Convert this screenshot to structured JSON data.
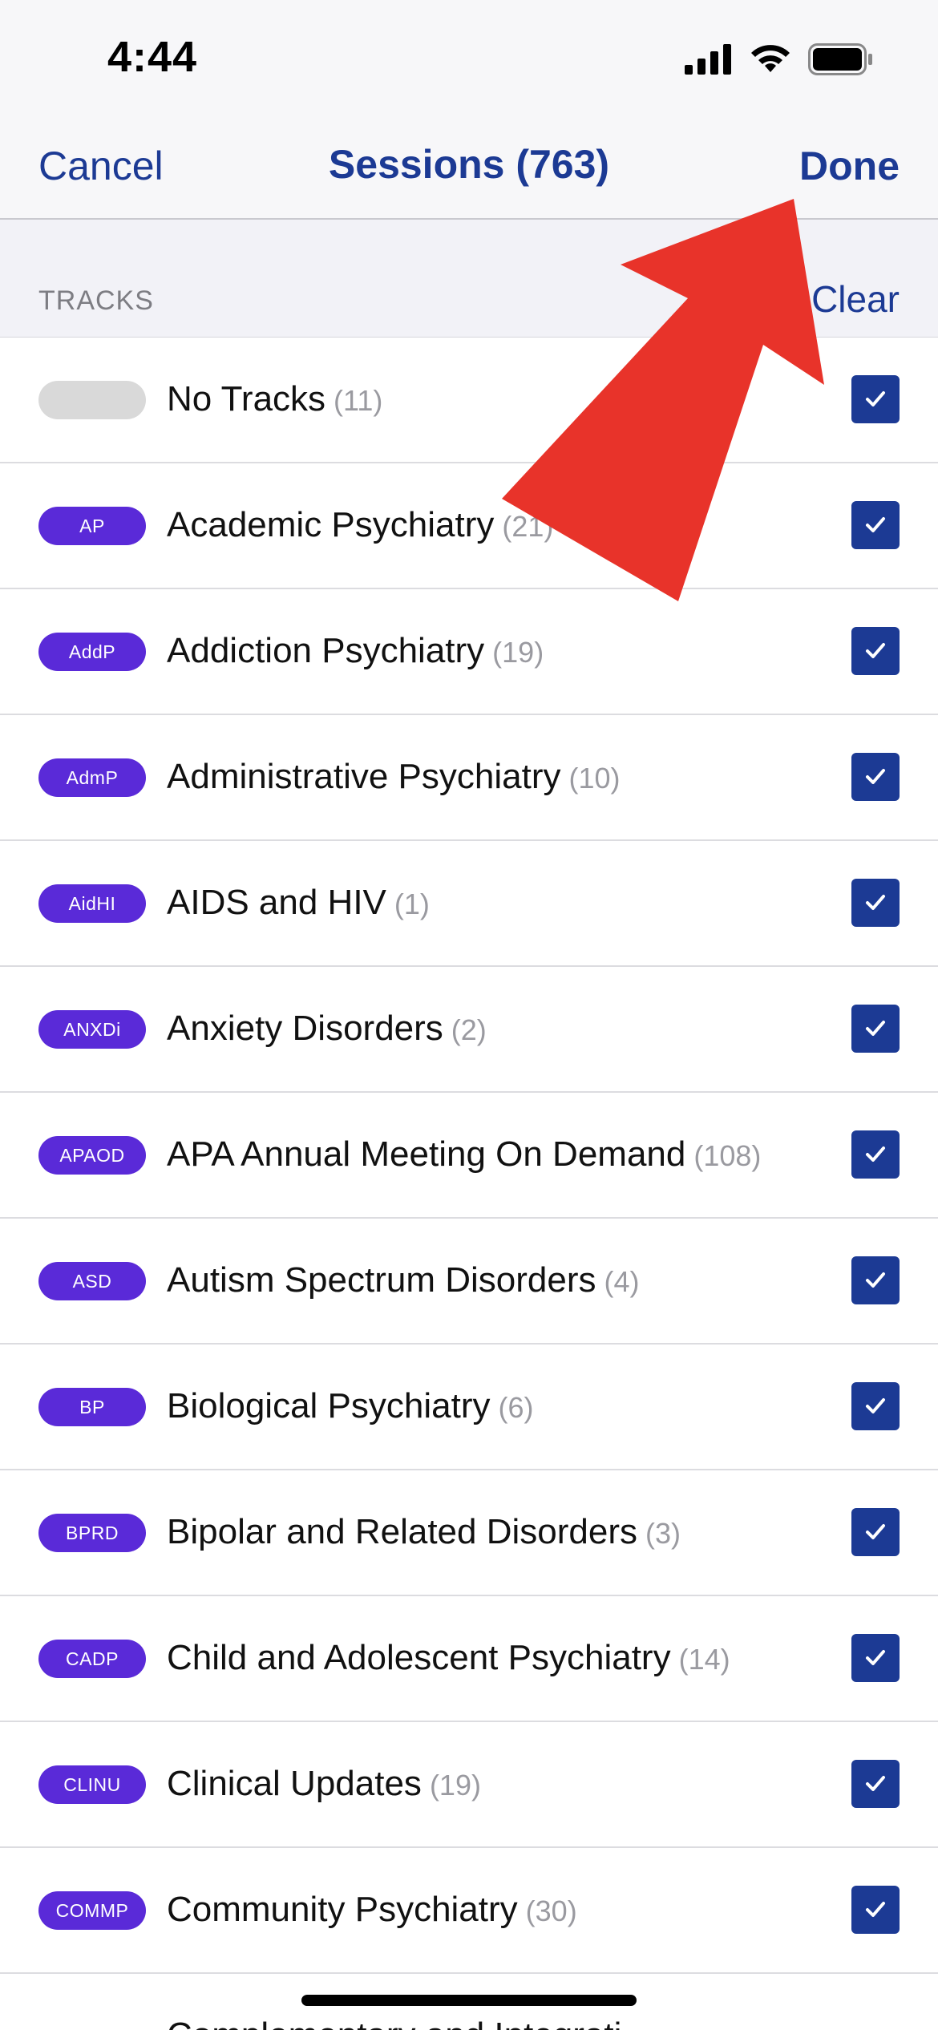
{
  "status_bar": {
    "time": "4:44",
    "icons": [
      "cellular-signal-icon",
      "wifi-icon",
      "battery-icon"
    ]
  },
  "nav": {
    "cancel_label": "Cancel",
    "title": "Sessions (763)",
    "done_label": "Done"
  },
  "section": {
    "title": "TRACKS",
    "clear_label": "Clear"
  },
  "tracks": [
    {
      "badge": "",
      "label": "No Tracks",
      "count": "(11)",
      "checked": true
    },
    {
      "badge": "AP",
      "label": "Academic Psychiatry",
      "count": "(21)",
      "checked": true
    },
    {
      "badge": "AddP",
      "label": "Addiction Psychiatry",
      "count": "(19)",
      "checked": true
    },
    {
      "badge": "AdmP",
      "label": "Administrative Psychiatry",
      "count": "(10)",
      "checked": true
    },
    {
      "badge": "AidHI",
      "label": "AIDS and HIV",
      "count": "(1)",
      "checked": true
    },
    {
      "badge": "ANXDi",
      "label": "Anxiety Disorders",
      "count": "(2)",
      "checked": true
    },
    {
      "badge": "APAOD",
      "label": "APA Annual Meeting On Demand",
      "count": "(108)",
      "checked": true
    },
    {
      "badge": "ASD",
      "label": "Autism Spectrum Disorders",
      "count": "(4)",
      "checked": true
    },
    {
      "badge": "BP",
      "label": "Biological Psychiatry",
      "count": "(6)",
      "checked": true
    },
    {
      "badge": "BPRD",
      "label": "Bipolar and Related Disorders",
      "count": "(3)",
      "checked": true
    },
    {
      "badge": "CADP",
      "label": "Child and Adolescent Psychiatry",
      "count": "(14)",
      "checked": true
    },
    {
      "badge": "CLINU",
      "label": "Clinical Updates",
      "count": "(19)",
      "checked": true
    },
    {
      "badge": "COMMP",
      "label": "Community Psychiatry",
      "count": "(30)",
      "checked": true
    }
  ],
  "partial_track_label": "Complementary and Integrati",
  "colors": {
    "accent": "#1c3a94",
    "badge": "#5a2ad8",
    "badge_empty": "#d9d9d9",
    "overlay_arrow": "#e8332a"
  }
}
